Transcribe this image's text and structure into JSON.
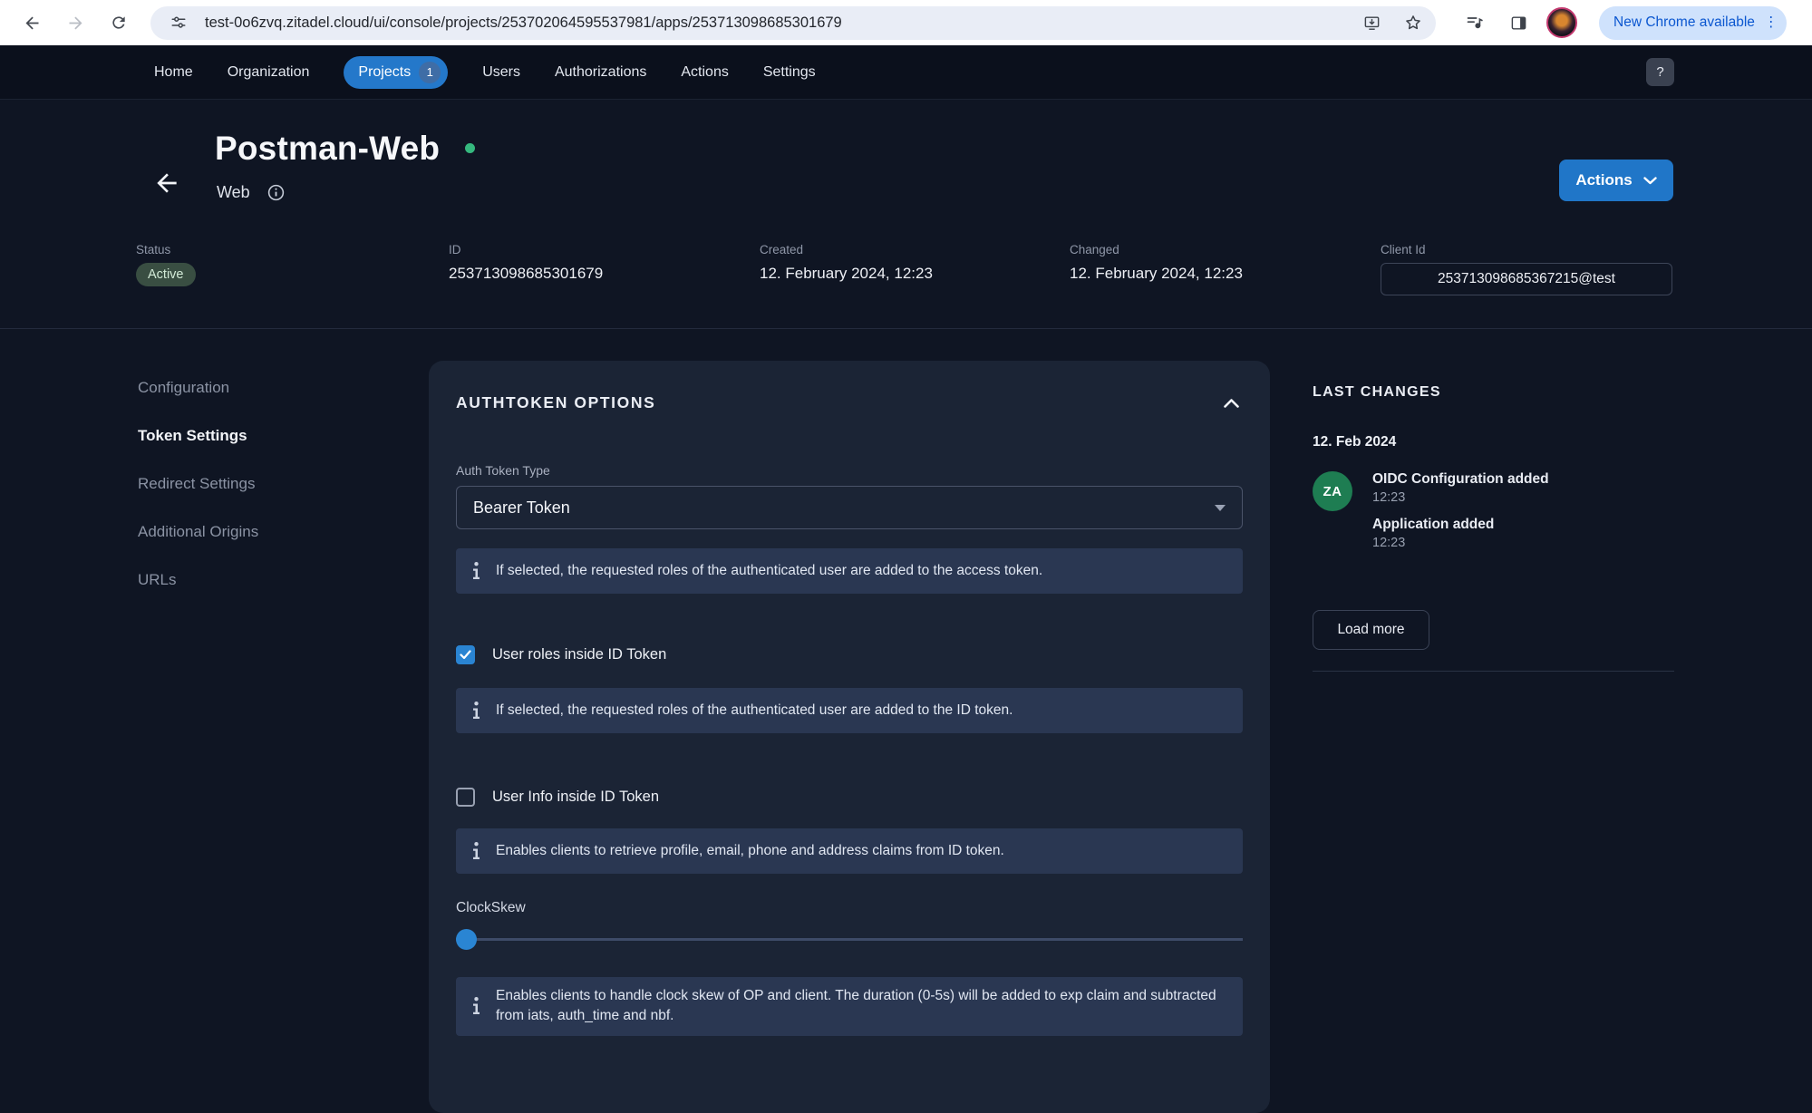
{
  "browser": {
    "url": "test-0o6zvq.zitadel.cloud/ui/console/projects/253702064595537981/apps/253713098685301679",
    "update_pill": "New Chrome available"
  },
  "navbar": {
    "items": [
      {
        "label": "Home"
      },
      {
        "label": "Organization"
      },
      {
        "label": "Projects"
      },
      {
        "label": "Users"
      },
      {
        "label": "Authorizations"
      },
      {
        "label": "Actions"
      },
      {
        "label": "Settings"
      }
    ],
    "projects_badge": "1",
    "help_label": "?"
  },
  "header": {
    "title": "Postman-Web",
    "subtitle": "Web",
    "actions_button": "Actions"
  },
  "meta": {
    "status_label": "Status",
    "status_value": "Active",
    "id_label": "ID",
    "id_value": "253713098685301679",
    "created_label": "Created",
    "created_value": "12. February 2024, 12:23",
    "changed_label": "Changed",
    "changed_value": "12. February 2024, 12:23",
    "client_id_label": "Client Id",
    "client_id_value": "253713098685367215@test"
  },
  "sidebar": {
    "items": [
      {
        "label": "Configuration"
      },
      {
        "label": "Token Settings"
      },
      {
        "label": "Redirect Settings"
      },
      {
        "label": "Additional Origins"
      },
      {
        "label": "URLs"
      }
    ],
    "active": "Token Settings"
  },
  "card": {
    "heading": "AUTHTOKEN OPTIONS",
    "auth_token_type_label": "Auth Token Type",
    "auth_token_type_value": "Bearer Token",
    "note_access_token": "If selected, the requested roles of the authenticated user are added to the access token.",
    "checkbox_roles": {
      "label": "User roles inside ID Token",
      "checked": true
    },
    "note_id_token": "If selected, the requested roles of the authenticated user are added to the ID token.",
    "checkbox_userinfo": {
      "label": "User Info inside ID Token",
      "checked": false
    },
    "note_userinfo": "Enables clients to retrieve profile, email, phone and address claims from ID token.",
    "clockskew_label": "ClockSkew",
    "note_clockskew": "Enables clients to handle clock skew of OP and client. The duration (0-5s) will be added to exp claim and subtracted from iats, auth_time and nbf."
  },
  "changes": {
    "heading": "LAST CHANGES",
    "date": "12. Feb 2024",
    "avatar_initials": "ZA",
    "events": [
      {
        "title": "OIDC Configuration added",
        "time": "12:23"
      },
      {
        "title": "Application added",
        "time": "12:23"
      }
    ],
    "load_more_label": "Load more"
  },
  "colors": {
    "accent_blue": "#2076c8",
    "page_background": "#0f1523",
    "card_background": "#1b2435",
    "note_background": "#2a3752",
    "status_green_bg": "#394e42",
    "status_green_text": "#d2ead7",
    "avatar_green": "#1e7d52",
    "title_dot_green": "#35b87e",
    "chrome_update_pill": "#cfe2fc"
  }
}
